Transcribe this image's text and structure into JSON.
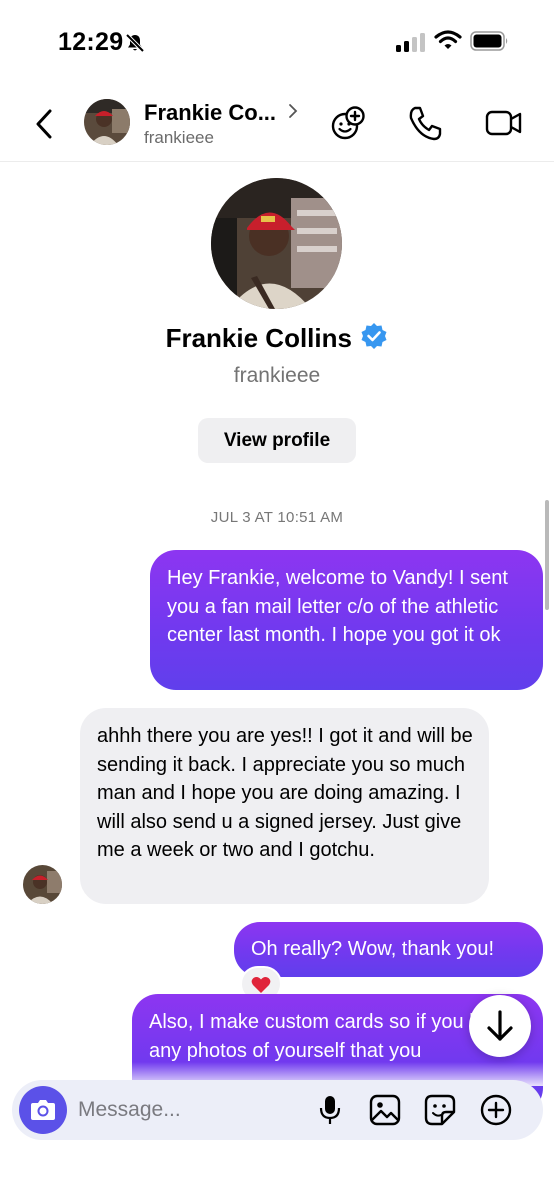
{
  "status_bar": {
    "time": "12:29",
    "icons": [
      "bell-slash-icon",
      "cellular-signal-icon",
      "wifi-icon",
      "battery-icon"
    ]
  },
  "header": {
    "name": "Frankie Co...",
    "handle": "frankieee",
    "icons": [
      "back-chevron-icon",
      "avatar",
      "chevron-right-icon",
      "add-people-icon",
      "phone-icon",
      "video-icon"
    ]
  },
  "profile": {
    "name": "Frankie Collins",
    "handle": "frankieee",
    "view_profile_label": "View profile",
    "verified_color": "#3797f0"
  },
  "conversation": {
    "timestamp": "JUL 3 AT 10:51 AM",
    "messages": [
      {
        "from": "me",
        "text": "Hey Frankie, welcome to Vandy! I sent you a fan mail letter c/o of the athletic center last month. I hope you got it ok"
      },
      {
        "from": "frankie",
        "text": "ahhh there you are yes!! I got it and will be sending it back. I appreciate you so much man and I hope you are doing amazing. I will also send u a signed jersey. Just give me a week or two and I gotchu."
      },
      {
        "from": "me",
        "text": "Oh really? Wow, thank you!",
        "reaction": "❤️"
      },
      {
        "from": "me",
        "text": "Also, I make custom cards so if you have any photos of yourself that you"
      }
    ]
  },
  "composer": {
    "placeholder": "Message...",
    "value": "",
    "icons": [
      "camera-icon",
      "microphone-icon",
      "image-icon",
      "sticker-icon",
      "plus-circle-icon"
    ]
  },
  "colors": {
    "outgoing_top": "#8d36f1",
    "outgoing_bottom": "#603fec",
    "incoming": "#efeff2",
    "camera_button": "#5b51e8"
  }
}
